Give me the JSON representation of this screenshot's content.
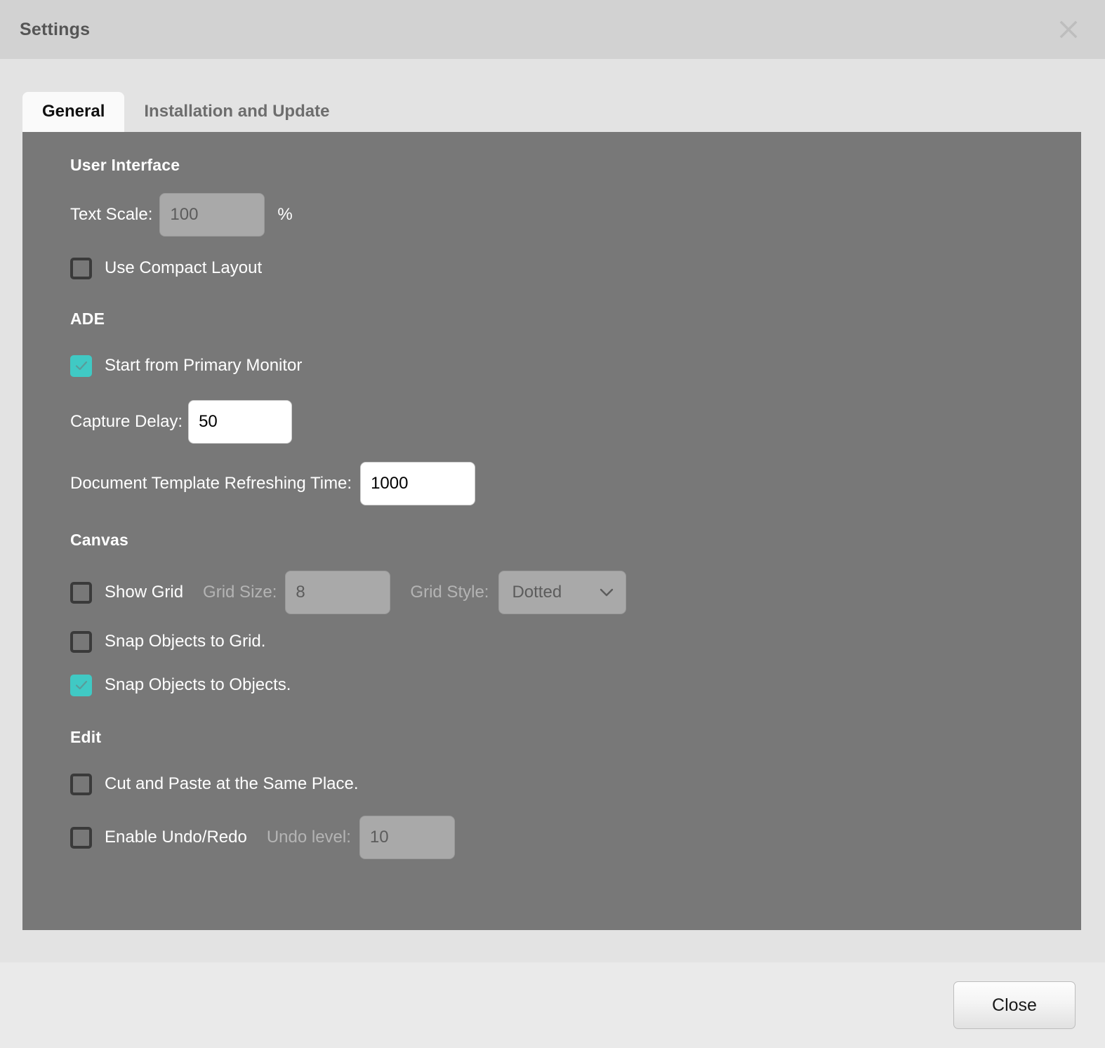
{
  "window": {
    "title": "Settings",
    "close_icon": "close-icon"
  },
  "tabs": [
    {
      "label": "General",
      "active": true
    },
    {
      "label": "Installation and Update",
      "active": false
    }
  ],
  "colors": {
    "panel_bg": "#787878",
    "titlebar_bg": "#d2d2d2",
    "tabstrip_bg": "#e3e3e3",
    "footer_bg": "#eaeaea",
    "checkbox_checked": "#40c9c4",
    "checkbox_border": "#3a3a3a",
    "label_text": "#ffffff",
    "label_disabled_text": "#b4b4b4",
    "input_disabled_bg": "#a9a9a9"
  },
  "sections": {
    "user_interface": {
      "title": "User Interface",
      "text_scale": {
        "label": "Text Scale:",
        "value": "",
        "placeholder": "100",
        "unit": "%",
        "enabled": false
      },
      "use_compact_layout": {
        "label": "Use Compact Layout",
        "checked": false
      }
    },
    "ade": {
      "title": "ADE",
      "start_from_primary_monitor": {
        "label": "Start from Primary Monitor",
        "checked": true
      },
      "capture_delay": {
        "label": "Capture Delay:",
        "value": "50",
        "enabled": true
      },
      "document_template_refreshing_time": {
        "label": "Document Template Refreshing Time:",
        "value": "1000",
        "enabled": true
      }
    },
    "canvas": {
      "title": "Canvas",
      "show_grid": {
        "label": "Show Grid",
        "checked": false
      },
      "grid_size": {
        "label": "Grid Size:",
        "value": "",
        "placeholder": "8",
        "enabled": false
      },
      "grid_style": {
        "label": "Grid Style:",
        "selected": "Dotted",
        "options": [
          "Dotted"
        ],
        "enabled": false,
        "chevron_icon": "chevron-down-icon"
      },
      "snap_objects_to_grid": {
        "label": "Snap Objects to Grid.",
        "checked": false
      },
      "snap_objects_to_objects": {
        "label": "Snap Objects to Objects.",
        "checked": true
      }
    },
    "edit": {
      "title": "Edit",
      "cut_and_paste_same_place": {
        "label": "Cut and Paste at the Same Place.",
        "checked": false
      },
      "enable_undo_redo": {
        "label": "Enable Undo/Redo",
        "checked": false
      },
      "undo_level": {
        "label": "Undo level:",
        "value": "",
        "placeholder": "10",
        "enabled": false
      }
    }
  },
  "footer": {
    "close_button": "Close"
  }
}
